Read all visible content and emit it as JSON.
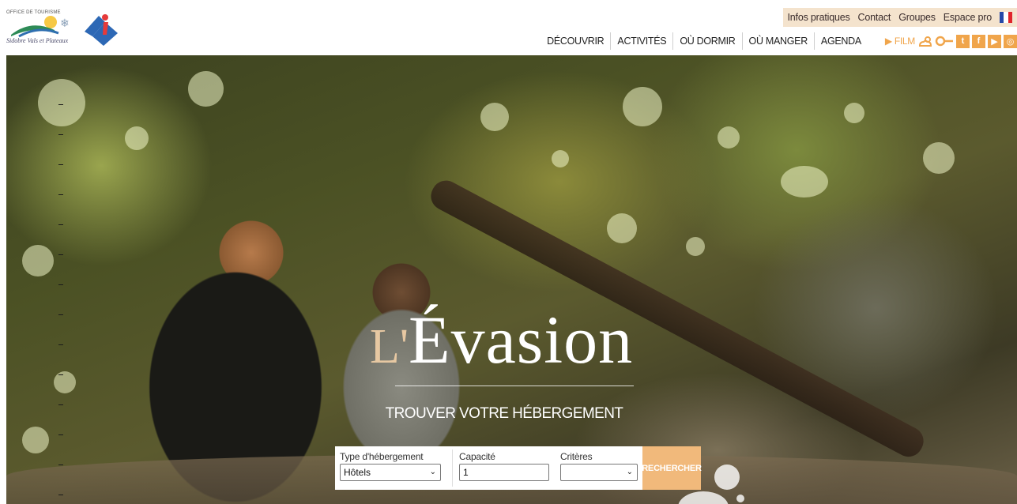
{
  "header": {
    "logo_small_text": "OFFICE DE TOURISME",
    "logo_script_text": "Sidobre Vals et Plateaux",
    "top_links": [
      "Infos pratiques",
      "Contact",
      "Groupes",
      "Espace pro"
    ],
    "nav_items": [
      "DÉCOUVRIR",
      "ACTIVITÉS",
      "OÙ DORMIR",
      "OÙ MANGER",
      "AGENDA"
    ],
    "film_label": "FILM",
    "colors": {
      "accent": "#f0a54b",
      "topbar_bg": "#f4e3cd"
    }
  },
  "hero": {
    "title_prefix": "L'",
    "title_main": "Évasion",
    "subtitle": "TROUVER VOTRE HÉBERGEMENT"
  },
  "search": {
    "type_label": "Type d'hébergement",
    "type_value": "Hôtels",
    "capacity_label": "Capacité",
    "capacity_value": "1",
    "criteria_label": "Critères",
    "criteria_value": "",
    "button_label": "RECHERCHER"
  }
}
